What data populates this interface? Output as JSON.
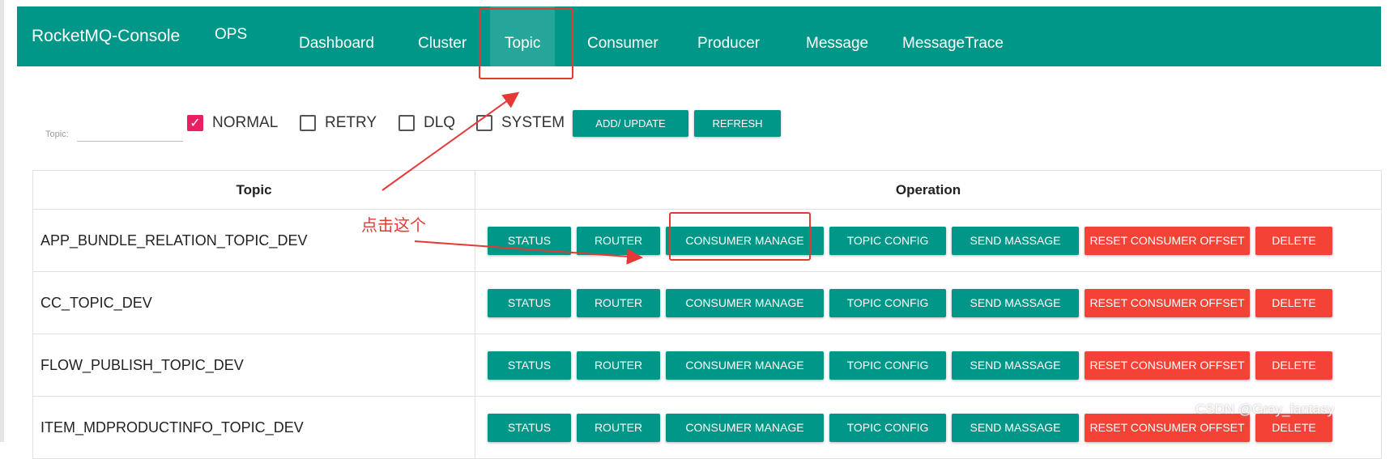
{
  "navbar": {
    "brand": "RocketMQ-Console",
    "items": [
      "OPS",
      "Dashboard",
      "Cluster",
      "Topic",
      "Consumer",
      "Producer",
      "Message",
      "MessageTrace"
    ],
    "active": "Topic"
  },
  "filter": {
    "topic_label": "Topic:",
    "topic_value": "",
    "checkboxes": [
      {
        "label": "NORMAL",
        "checked": true
      },
      {
        "label": "RETRY",
        "checked": false
      },
      {
        "label": "DLQ",
        "checked": false
      },
      {
        "label": "SYSTEM",
        "checked": false
      }
    ],
    "add_update": "ADD/ UPDATE",
    "refresh": "REFRESH"
  },
  "table": {
    "headers": [
      "Topic",
      "Operation"
    ],
    "operations": [
      "STATUS",
      "ROUTER",
      "CONSUMER MANAGE",
      "TOPIC CONFIG",
      "SEND MASSAGE",
      "RESET CONSUMER OFFSET",
      "DELETE"
    ],
    "rows": [
      "APP_BUNDLE_RELATION_TOPIC_DEV",
      "CC_TOPIC_DEV",
      "FLOW_PUBLISH_TOPIC_DEV",
      "ITEM_MDPRODUCTINFO_TOPIC_DEV"
    ]
  },
  "annotation": {
    "text": "点击这个",
    "color": "#e53935"
  },
  "watermark": "CSDN @Grey_fantasy",
  "colors": {
    "primary": "#009688",
    "danger": "#f44336",
    "checked": "#e91e63"
  }
}
